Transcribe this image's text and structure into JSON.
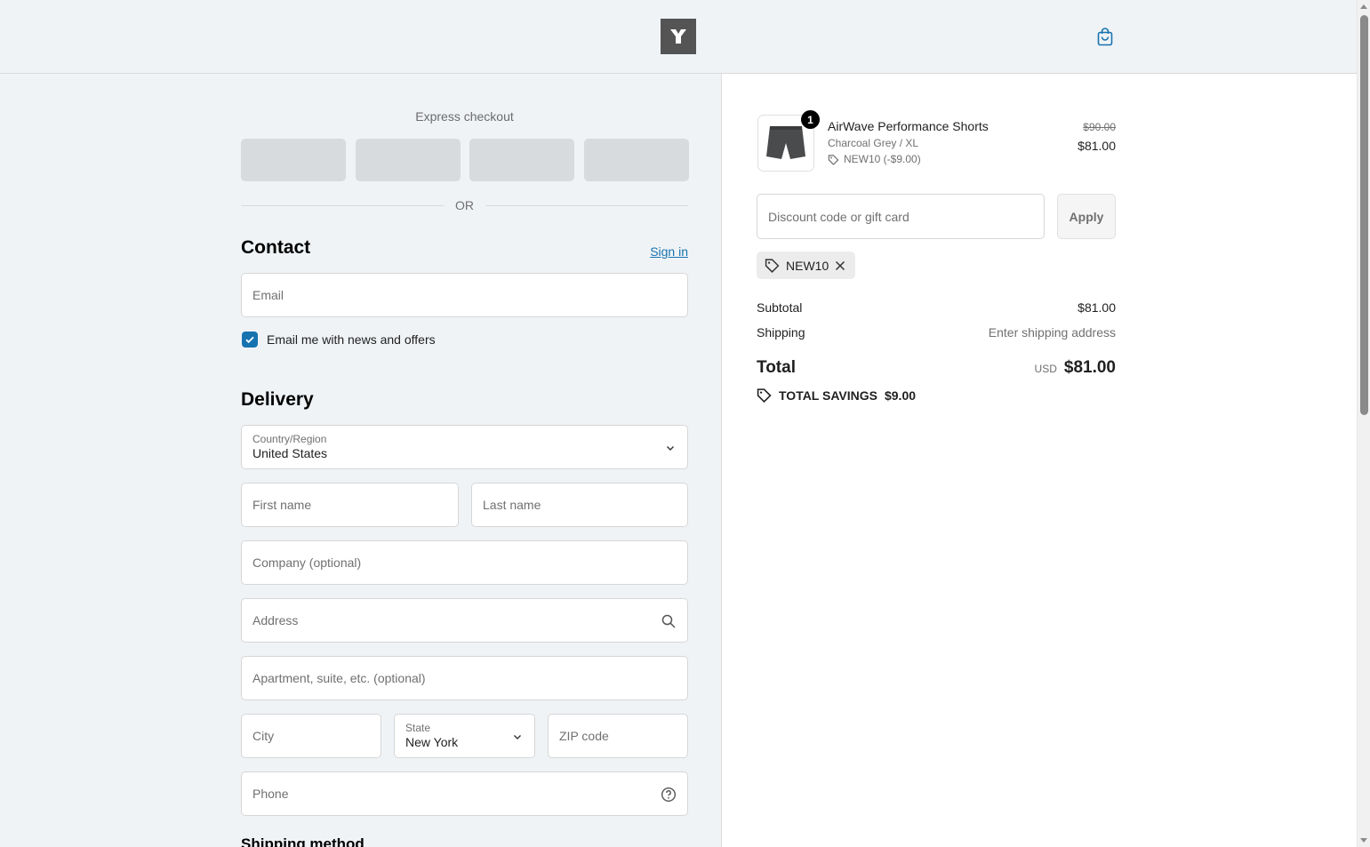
{
  "header": {
    "logo": "logo-icon",
    "cart": "shopping-bag-icon",
    "accent_color": "#1773b0"
  },
  "express": {
    "title": "Express checkout",
    "or_text": "OR"
  },
  "contact": {
    "heading": "Contact",
    "sign_in": "Sign in",
    "email_placeholder": "Email",
    "newsletter_label": "Email me with news and offers",
    "newsletter_checked": true
  },
  "delivery": {
    "heading": "Delivery",
    "country_label": "Country/Region",
    "country_value": "United States",
    "first_name_placeholder": "First name",
    "last_name_placeholder": "Last name",
    "company_placeholder": "Company (optional)",
    "address_placeholder": "Address",
    "apartment_placeholder": "Apartment, suite, etc. (optional)",
    "city_placeholder": "City",
    "state_label": "State",
    "state_value": "New York",
    "zip_placeholder": "ZIP code",
    "phone_placeholder": "Phone"
  },
  "shipping_method": {
    "heading": "Shipping method"
  },
  "summary": {
    "product": {
      "name": "AirWave Performance Shorts",
      "variant": "Charcoal Grey / XL",
      "discount": "NEW10 (-$9.00)",
      "quantity": "1",
      "old_price": "$90.00",
      "price": "$81.00"
    },
    "discount_placeholder": "Discount code or gift card",
    "apply_label": "Apply",
    "applied_code": "NEW10",
    "subtotal_label": "Subtotal",
    "subtotal_value": "$81.00",
    "shipping_label": "Shipping",
    "shipping_value": "Enter shipping address",
    "total_label": "Total",
    "total_currency": "USD",
    "total_value": "$81.00",
    "savings_label": "TOTAL SAVINGS",
    "savings_value": "$9.00"
  }
}
